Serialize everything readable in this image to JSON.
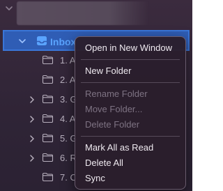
{
  "sidebar": {
    "inbox": {
      "label": "Inbox",
      "icon": "inbox-tray-icon",
      "expanded": true,
      "selected": true
    },
    "folders": [
      {
        "label": "1. A",
        "expandable": false
      },
      {
        "label": "2. A",
        "expandable": false
      },
      {
        "label": "3. G",
        "expandable": true
      },
      {
        "label": "4. A",
        "expandable": true
      },
      {
        "label": "5. G",
        "expandable": true
      },
      {
        "label": "6. R",
        "expandable": true
      },
      {
        "label": "7. C",
        "expandable": false
      }
    ]
  },
  "context_menu": {
    "items": [
      {
        "label": "Open in New Window",
        "enabled": true
      },
      {
        "separator": true
      },
      {
        "label": "New Folder",
        "enabled": true
      },
      {
        "separator": true
      },
      {
        "label": "Rename Folder",
        "enabled": false
      },
      {
        "label": "Move Folder...",
        "enabled": false
      },
      {
        "label": "Delete Folder",
        "enabled": false
      },
      {
        "separator": true
      },
      {
        "label": "Mark All as Read",
        "enabled": true
      },
      {
        "label": "Delete All",
        "enabled": true
      },
      {
        "label": "Sync",
        "enabled": true
      }
    ]
  },
  "colors": {
    "background": "#2f2436",
    "selection": "#2f5db5",
    "selection_border": "#3a76d8",
    "inbox_text": "#5aa4ff",
    "menu_background": "#2a1e2c",
    "menu_text": "#efeaf0",
    "menu_disabled_text": "#7e7383"
  }
}
